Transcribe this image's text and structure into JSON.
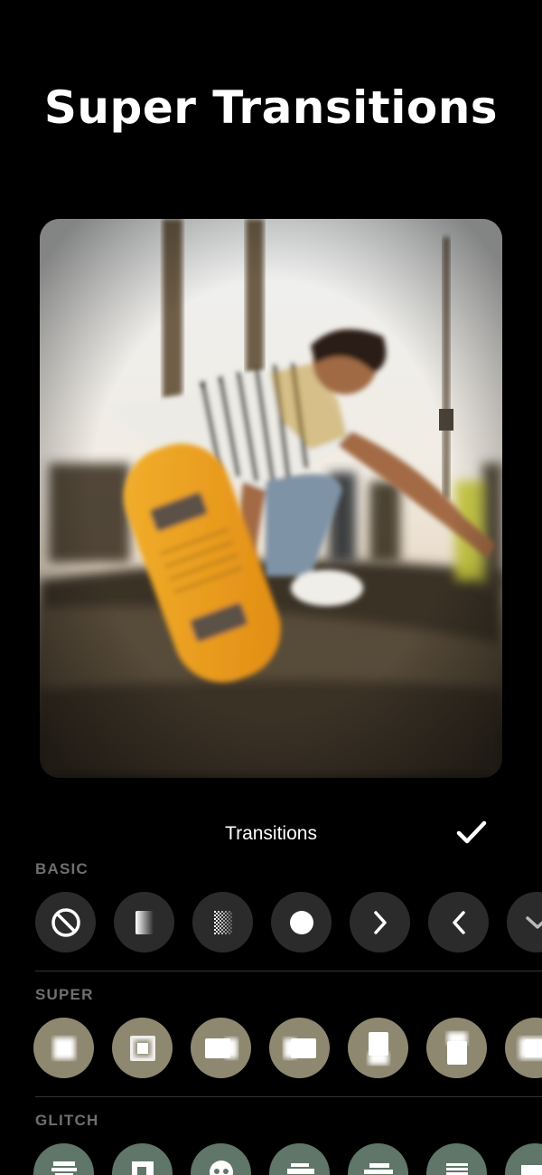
{
  "hero": {
    "title": "Super Transitions"
  },
  "editor": {
    "title": "Transitions",
    "confirm_icon": "checkmark-icon"
  },
  "sections": {
    "basic": {
      "label": "BASIC",
      "items": [
        "no-transition-icon",
        "fade-gradient-icon",
        "dissolve-icon",
        "circle-icon",
        "slide-right-icon",
        "slide-left-icon",
        "slide-down-icon"
      ]
    },
    "super": {
      "label": "SUPER",
      "items": [
        "zoom-in-icon",
        "zoom-out-icon",
        "slide-blur-right-icon",
        "slide-blur-left-icon",
        "slide-blur-down-icon",
        "slide-blur-up-icon",
        "spin-blur-icon"
      ]
    },
    "glitch": {
      "label": "GLITCH",
      "items": [
        "glitch-1-icon",
        "glitch-2-icon",
        "glitch-3-icon",
        "glitch-4-icon",
        "glitch-5-icon",
        "glitch-6-icon",
        "glitch-7-icon"
      ]
    }
  },
  "colors": {
    "background": "#000000",
    "basic_tile": "#2b2b2b",
    "super_tile": "#8e8871",
    "glitch_tile": "#5f7668",
    "section_label": "#6f6f6f"
  }
}
